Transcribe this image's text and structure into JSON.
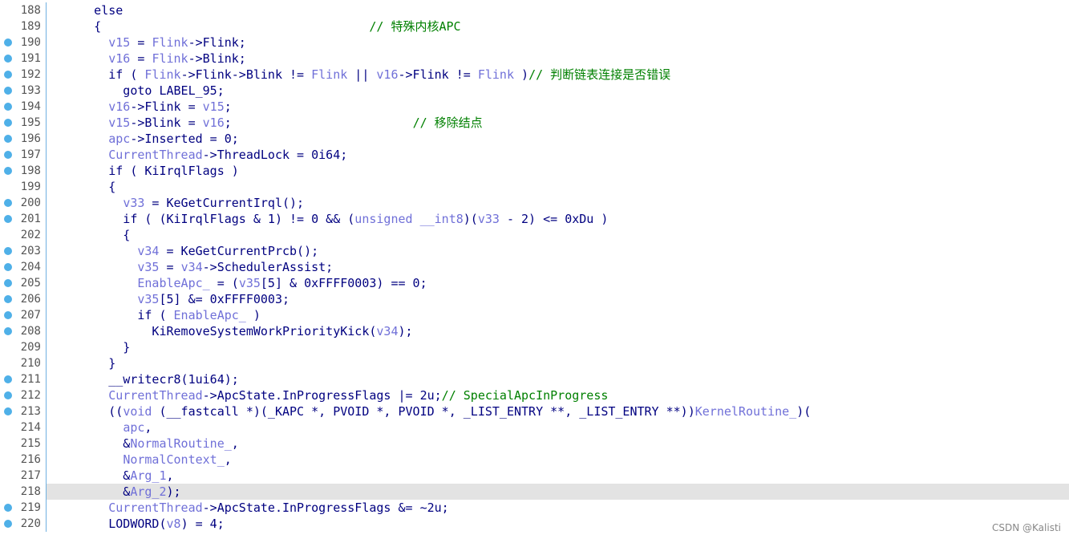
{
  "colors": {
    "text": "#000080",
    "variable": "#7070d8",
    "comment": "#008000",
    "line_number": "#555555",
    "breakpoint_dot": "#4fb0e8",
    "gutter_border": "#6fb0e0",
    "highlight": "#e3e3e3"
  },
  "watermark": "CSDN @Kalisti",
  "lines": [
    {
      "n": "188",
      "dot": false,
      "tokens": [
        [
          "k",
          "      else"
        ]
      ]
    },
    {
      "n": "189",
      "dot": false,
      "tokens": [
        [
          "k",
          "      {                                     "
        ],
        [
          "c",
          "// 特殊内核APC"
        ]
      ]
    },
    {
      "n": "190",
      "dot": true,
      "tokens": [
        [
          "k",
          "        "
        ],
        [
          "v",
          "v15"
        ],
        [
          "k",
          " = "
        ],
        [
          "v",
          "Flink"
        ],
        [
          "k",
          "->Flink;"
        ]
      ]
    },
    {
      "n": "191",
      "dot": true,
      "tokens": [
        [
          "k",
          "        "
        ],
        [
          "v",
          "v16"
        ],
        [
          "k",
          " = "
        ],
        [
          "v",
          "Flink"
        ],
        [
          "k",
          "->Blink;"
        ]
      ]
    },
    {
      "n": "192",
      "dot": true,
      "tokens": [
        [
          "k",
          "        if ( "
        ],
        [
          "v",
          "Flink"
        ],
        [
          "k",
          "->Flink->Blink != "
        ],
        [
          "v",
          "Flink"
        ],
        [
          "k",
          " || "
        ],
        [
          "v",
          "v16"
        ],
        [
          "k",
          "->Flink != "
        ],
        [
          "v",
          "Flink"
        ],
        [
          "k",
          " )"
        ],
        [
          "c",
          "// 判断链表连接是否错误"
        ]
      ]
    },
    {
      "n": "193",
      "dot": true,
      "tokens": [
        [
          "k",
          "          goto LABEL_95;"
        ]
      ]
    },
    {
      "n": "194",
      "dot": true,
      "tokens": [
        [
          "k",
          "        "
        ],
        [
          "v",
          "v16"
        ],
        [
          "k",
          "->Flink = "
        ],
        [
          "v",
          "v15"
        ],
        [
          "k",
          ";"
        ]
      ]
    },
    {
      "n": "195",
      "dot": true,
      "tokens": [
        [
          "k",
          "        "
        ],
        [
          "v",
          "v15"
        ],
        [
          "k",
          "->Blink = "
        ],
        [
          "v",
          "v16"
        ],
        [
          "k",
          ";                         "
        ],
        [
          "c",
          "// 移除结点"
        ]
      ]
    },
    {
      "n": "196",
      "dot": true,
      "tokens": [
        [
          "k",
          "        "
        ],
        [
          "v",
          "apc"
        ],
        [
          "k",
          "->Inserted = 0;"
        ]
      ]
    },
    {
      "n": "197",
      "dot": true,
      "tokens": [
        [
          "k",
          "        "
        ],
        [
          "v",
          "CurrentThread"
        ],
        [
          "k",
          "->ThreadLock = 0i64;"
        ]
      ]
    },
    {
      "n": "198",
      "dot": true,
      "tokens": [
        [
          "k",
          "        if ( "
        ],
        [
          "k",
          "KiIrqlFlags"
        ],
        [
          "k",
          " )"
        ]
      ]
    },
    {
      "n": "199",
      "dot": false,
      "tokens": [
        [
          "k",
          "        {"
        ]
      ]
    },
    {
      "n": "200",
      "dot": true,
      "tokens": [
        [
          "k",
          "          "
        ],
        [
          "v",
          "v33"
        ],
        [
          "k",
          " = KeGetCurrentIrql();"
        ]
      ]
    },
    {
      "n": "201",
      "dot": true,
      "tokens": [
        [
          "k",
          "          if ( (KiIrqlFlags & 1) != 0 && ("
        ],
        [
          "v",
          "unsigned __int8"
        ],
        [
          "k",
          ")("
        ],
        [
          "v",
          "v33"
        ],
        [
          "k",
          " - 2) <= 0xDu )"
        ]
      ]
    },
    {
      "n": "202",
      "dot": false,
      "tokens": [
        [
          "k",
          "          {"
        ]
      ]
    },
    {
      "n": "203",
      "dot": true,
      "tokens": [
        [
          "k",
          "            "
        ],
        [
          "v",
          "v34"
        ],
        [
          "k",
          " = KeGetCurrentPrcb();"
        ]
      ]
    },
    {
      "n": "204",
      "dot": true,
      "tokens": [
        [
          "k",
          "            "
        ],
        [
          "v",
          "v35"
        ],
        [
          "k",
          " = "
        ],
        [
          "v",
          "v34"
        ],
        [
          "k",
          "->SchedulerAssist;"
        ]
      ]
    },
    {
      "n": "205",
      "dot": true,
      "tokens": [
        [
          "k",
          "            "
        ],
        [
          "v",
          "EnableApc_"
        ],
        [
          "k",
          " = ("
        ],
        [
          "v",
          "v35"
        ],
        [
          "k",
          "[5] & 0xFFFF0003) == 0;"
        ]
      ]
    },
    {
      "n": "206",
      "dot": true,
      "tokens": [
        [
          "k",
          "            "
        ],
        [
          "v",
          "v35"
        ],
        [
          "k",
          "[5] &= 0xFFFF0003;"
        ]
      ]
    },
    {
      "n": "207",
      "dot": true,
      "tokens": [
        [
          "k",
          "            if ( "
        ],
        [
          "v",
          "EnableApc_"
        ],
        [
          "k",
          " )"
        ]
      ]
    },
    {
      "n": "208",
      "dot": true,
      "tokens": [
        [
          "k",
          "              KiRemoveSystemWorkPriorityKick("
        ],
        [
          "v",
          "v34"
        ],
        [
          "k",
          ");"
        ]
      ]
    },
    {
      "n": "209",
      "dot": false,
      "tokens": [
        [
          "k",
          "          }"
        ]
      ]
    },
    {
      "n": "210",
      "dot": false,
      "tokens": [
        [
          "k",
          "        }"
        ]
      ]
    },
    {
      "n": "211",
      "dot": true,
      "tokens": [
        [
          "k",
          "        __writecr8(1ui64);"
        ]
      ]
    },
    {
      "n": "212",
      "dot": true,
      "tokens": [
        [
          "k",
          "        "
        ],
        [
          "v",
          "CurrentThread"
        ],
        [
          "k",
          "->ApcState.InProgressFlags |= 2u;"
        ],
        [
          "c",
          "// SpecialApcInProgress"
        ]
      ]
    },
    {
      "n": "213",
      "dot": true,
      "tokens": [
        [
          "k",
          "        (("
        ],
        [
          "v",
          "void"
        ],
        [
          "k",
          " (__fastcall *)(_KAPC *, PVOID *, PVOID *, _LIST_ENTRY **, _LIST_ENTRY **))"
        ],
        [
          "v",
          "KernelRoutine_"
        ],
        [
          "k",
          ")("
        ]
      ]
    },
    {
      "n": "214",
      "dot": false,
      "tokens": [
        [
          "k",
          "          "
        ],
        [
          "v",
          "apc"
        ],
        [
          "k",
          ","
        ]
      ]
    },
    {
      "n": "215",
      "dot": false,
      "tokens": [
        [
          "k",
          "          &"
        ],
        [
          "v",
          "NormalRoutine_"
        ],
        [
          "k",
          ","
        ]
      ]
    },
    {
      "n": "216",
      "dot": false,
      "tokens": [
        [
          "k",
          "          "
        ],
        [
          "v",
          "NormalContext_"
        ],
        [
          "k",
          ","
        ]
      ]
    },
    {
      "n": "217",
      "dot": false,
      "tokens": [
        [
          "k",
          "          &"
        ],
        [
          "v",
          "Arg_1"
        ],
        [
          "k",
          ","
        ]
      ]
    },
    {
      "n": "218",
      "dot": false,
      "hl": true,
      "tokens": [
        [
          "k",
          "          &"
        ],
        [
          "v",
          "Arg_2"
        ],
        [
          "k",
          ");"
        ]
      ]
    },
    {
      "n": "219",
      "dot": true,
      "tokens": [
        [
          "k",
          "        "
        ],
        [
          "v",
          "CurrentThread"
        ],
        [
          "k",
          "->ApcState.InProgressFlags &= ~2u;"
        ]
      ]
    },
    {
      "n": "220",
      "dot": true,
      "tokens": [
        [
          "k",
          "        LODWORD("
        ],
        [
          "v",
          "v8"
        ],
        [
          "k",
          ") = 4;"
        ]
      ]
    }
  ]
}
